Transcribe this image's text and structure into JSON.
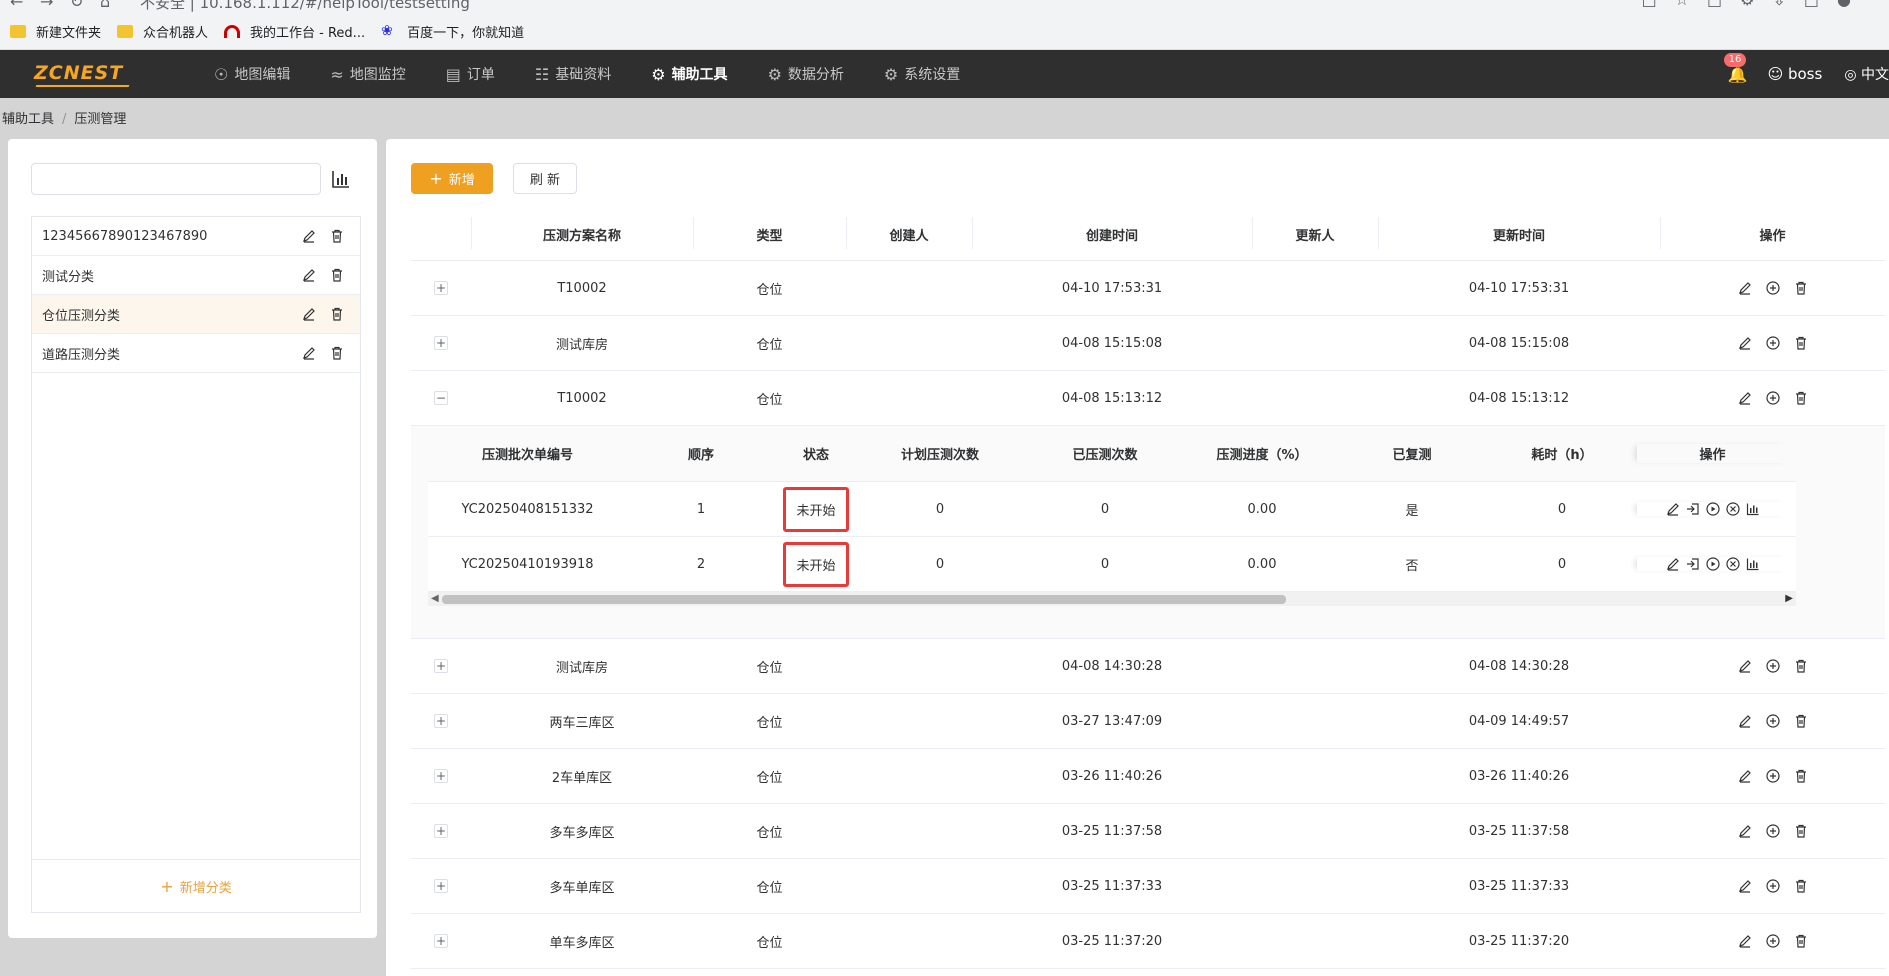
{
  "browser": {
    "url": "不安全 | 10.168.1.112/#/helpTool/testsetting",
    "bookmarks": [
      "新建文件夹",
      "众合机器人",
      "我的工作台 - Red...",
      "百度一下，你就知道"
    ]
  },
  "topnav": {
    "logo": "ZCNEST",
    "menu": [
      "地图编辑",
      "地图监控",
      "订单",
      "基础资料",
      "辅助工具",
      "数据分析",
      "系统设置"
    ],
    "active_menu": "辅助工具",
    "notification_count": "16",
    "user": "boss",
    "language": "中文"
  },
  "breadcrumb": {
    "root": "辅助工具",
    "current": "压测管理"
  },
  "sidebar": {
    "search_placeholder": "",
    "categories": [
      "12345667890123467890",
      "测试分类",
      "仓位压测分类",
      "道路压测分类"
    ],
    "selected_index": 2,
    "add_label": "新增分类"
  },
  "toolbar": {
    "add_label": "新增",
    "refresh_label": "刷 新"
  },
  "table": {
    "columns": [
      "压测方案名称",
      "类型",
      "创建人",
      "创建时间",
      "更新人",
      "更新时间",
      "操作"
    ],
    "rows": [
      {
        "name": "T10002",
        "type": "仓位",
        "creator": "",
        "created": "04-10 17:53:31",
        "updater": "",
        "updated": "04-10 17:53:31",
        "expanded": false
      },
      {
        "name": "测试库房",
        "type": "仓位",
        "creator": "",
        "created": "04-08 15:15:08",
        "updater": "",
        "updated": "04-08 15:15:08",
        "expanded": false
      },
      {
        "name": "T10002",
        "type": "仓位",
        "creator": "",
        "created": "04-08 15:13:12",
        "updater": "",
        "updated": "04-08 15:13:12",
        "expanded": true
      },
      {
        "name": "测试库房",
        "type": "仓位",
        "creator": "",
        "created": "04-08 14:30:28",
        "updater": "",
        "updated": "04-08 14:30:28",
        "expanded": false
      },
      {
        "name": "两车三库区",
        "type": "仓位",
        "creator": "",
        "created": "03-27 13:47:09",
        "updater": "",
        "updated": "04-09 14:49:57",
        "expanded": false
      },
      {
        "name": "2车单库区",
        "type": "仓位",
        "creator": "",
        "created": "03-26 11:40:26",
        "updater": "",
        "updated": "03-26 11:40:26",
        "expanded": false
      },
      {
        "name": "多车多库区",
        "type": "仓位",
        "creator": "",
        "created": "03-25 11:37:58",
        "updater": "",
        "updated": "03-25 11:37:58",
        "expanded": false
      },
      {
        "name": "多车单库区",
        "type": "仓位",
        "creator": "",
        "created": "03-25 11:37:33",
        "updater": "",
        "updated": "03-25 11:37:33",
        "expanded": false
      },
      {
        "name": "单车多库区",
        "type": "仓位",
        "creator": "",
        "created": "03-25 11:37:20",
        "updater": "",
        "updated": "03-25 11:37:20",
        "expanded": false
      }
    ]
  },
  "subtable": {
    "columns": [
      "压测批次单编号",
      "顺序",
      "状态",
      "计划压测次数",
      "已压测次数",
      "压测进度（%）",
      "已复测",
      "耗时（h）",
      "操作"
    ],
    "rows": [
      {
        "batch": "YC20250408151332",
        "order": "1",
        "status": "未开始",
        "planned": "0",
        "done": "0",
        "progress": "0.00",
        "retested": "是",
        "hours": "0"
      },
      {
        "batch": "YC20250410193918",
        "order": "2",
        "status": "未开始",
        "planned": "0",
        "done": "0",
        "progress": "0.00",
        "retested": "否",
        "hours": "0"
      }
    ],
    "scroll_position": 0.63
  },
  "colors": {
    "accent": "#f0a020",
    "nav_bg": "#2f2f2f",
    "highlight_border": "#e8393b",
    "selected_row": "#fdf6ec"
  }
}
